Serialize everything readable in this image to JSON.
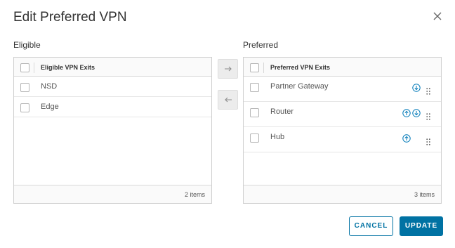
{
  "dialog": {
    "title": "Edit Preferred VPN"
  },
  "eligible": {
    "section_label": "Eligible",
    "column_header": "Eligible VPN Exits",
    "items": [
      "NSD",
      "Edge"
    ],
    "footer_count": "2 items"
  },
  "preferred": {
    "section_label": "Preferred",
    "column_header": "Preferred VPN Exits",
    "items": [
      "Partner Gateway",
      "Router",
      "Hub"
    ],
    "footer_count": "3 items"
  },
  "buttons": {
    "cancel": "CANCEL",
    "update": "UPDATE"
  },
  "icons": {
    "close": "close-icon",
    "move_right": "arrow-right-icon",
    "move_left": "arrow-left-icon",
    "move_up": "arrow-up-circle-icon",
    "move_down": "arrow-down-circle-icon",
    "drag": "drag-handle-icon"
  },
  "colors": {
    "accent": "#0072a3",
    "icon_blue": "#0079b8"
  }
}
